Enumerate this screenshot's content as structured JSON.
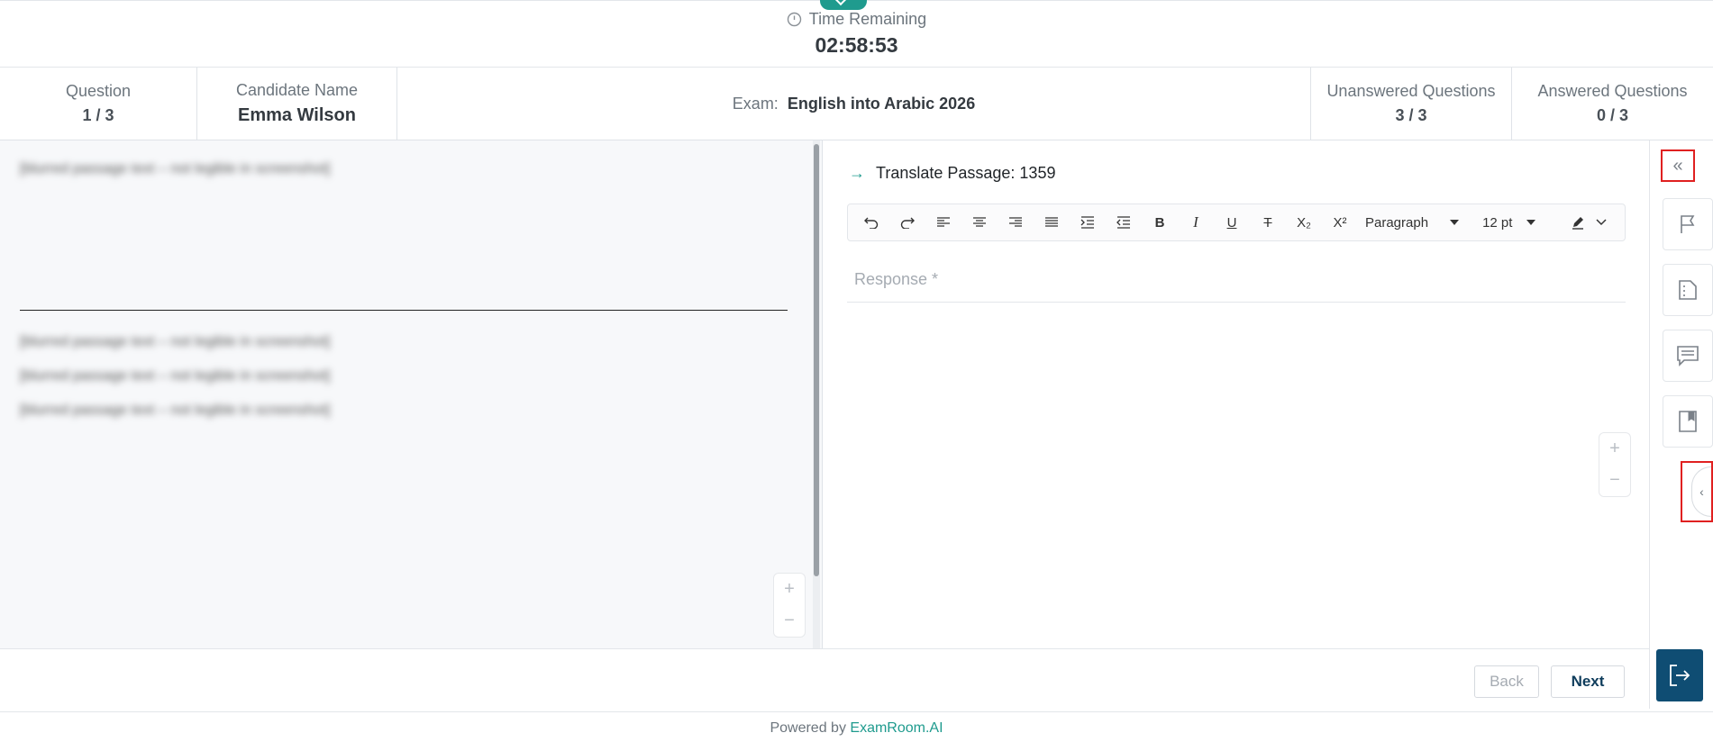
{
  "timer": {
    "label": "Time Remaining",
    "value": "02:58:53"
  },
  "info": {
    "question_label": "Question",
    "question_value": "1 / 3",
    "candidate_label": "Candidate Name",
    "candidate_value": "Emma Wilson",
    "exam_label": "Exam:",
    "exam_value": "English into Arabic 2026",
    "unanswered_label": "Unanswered Questions",
    "unanswered_value": "3 / 3",
    "answered_label": "Answered Questions",
    "answered_value": "0 / 3"
  },
  "passage": {
    "paragraphs": [
      "[blurred passage text – not legible in screenshot]",
      "[blurred passage text – not legible in screenshot]",
      "[blurred passage text – not legible in screenshot]",
      "[blurred passage text – not legible in screenshot]"
    ],
    "zoom_in": "+",
    "zoom_out": "−"
  },
  "editor": {
    "task_arrow": "→",
    "task_title": "Translate Passage: 1359",
    "block_format": "Paragraph",
    "font_size": "12 pt",
    "bold": "B",
    "italic": "I",
    "underline": "U",
    "strike": "T",
    "subscript": "X₂",
    "superscript": "X²",
    "response_placeholder": "Response *",
    "zoom_in": "+",
    "zoom_out": "−"
  },
  "rail": {
    "collapse": "«",
    "side_toggle": "‹",
    "icons": [
      "flag-icon",
      "notes-page-icon",
      "comment-icon",
      "bookmark-icon",
      "exit-icon"
    ]
  },
  "nav": {
    "back": "Back",
    "next": "Next"
  },
  "footer": {
    "prefix": "Powered by ",
    "brand": "ExamRoom.AI"
  },
  "colors": {
    "accent_teal": "#1f9b8e",
    "exit_navy": "#0f4d73",
    "highlight_red": "#e02020"
  }
}
